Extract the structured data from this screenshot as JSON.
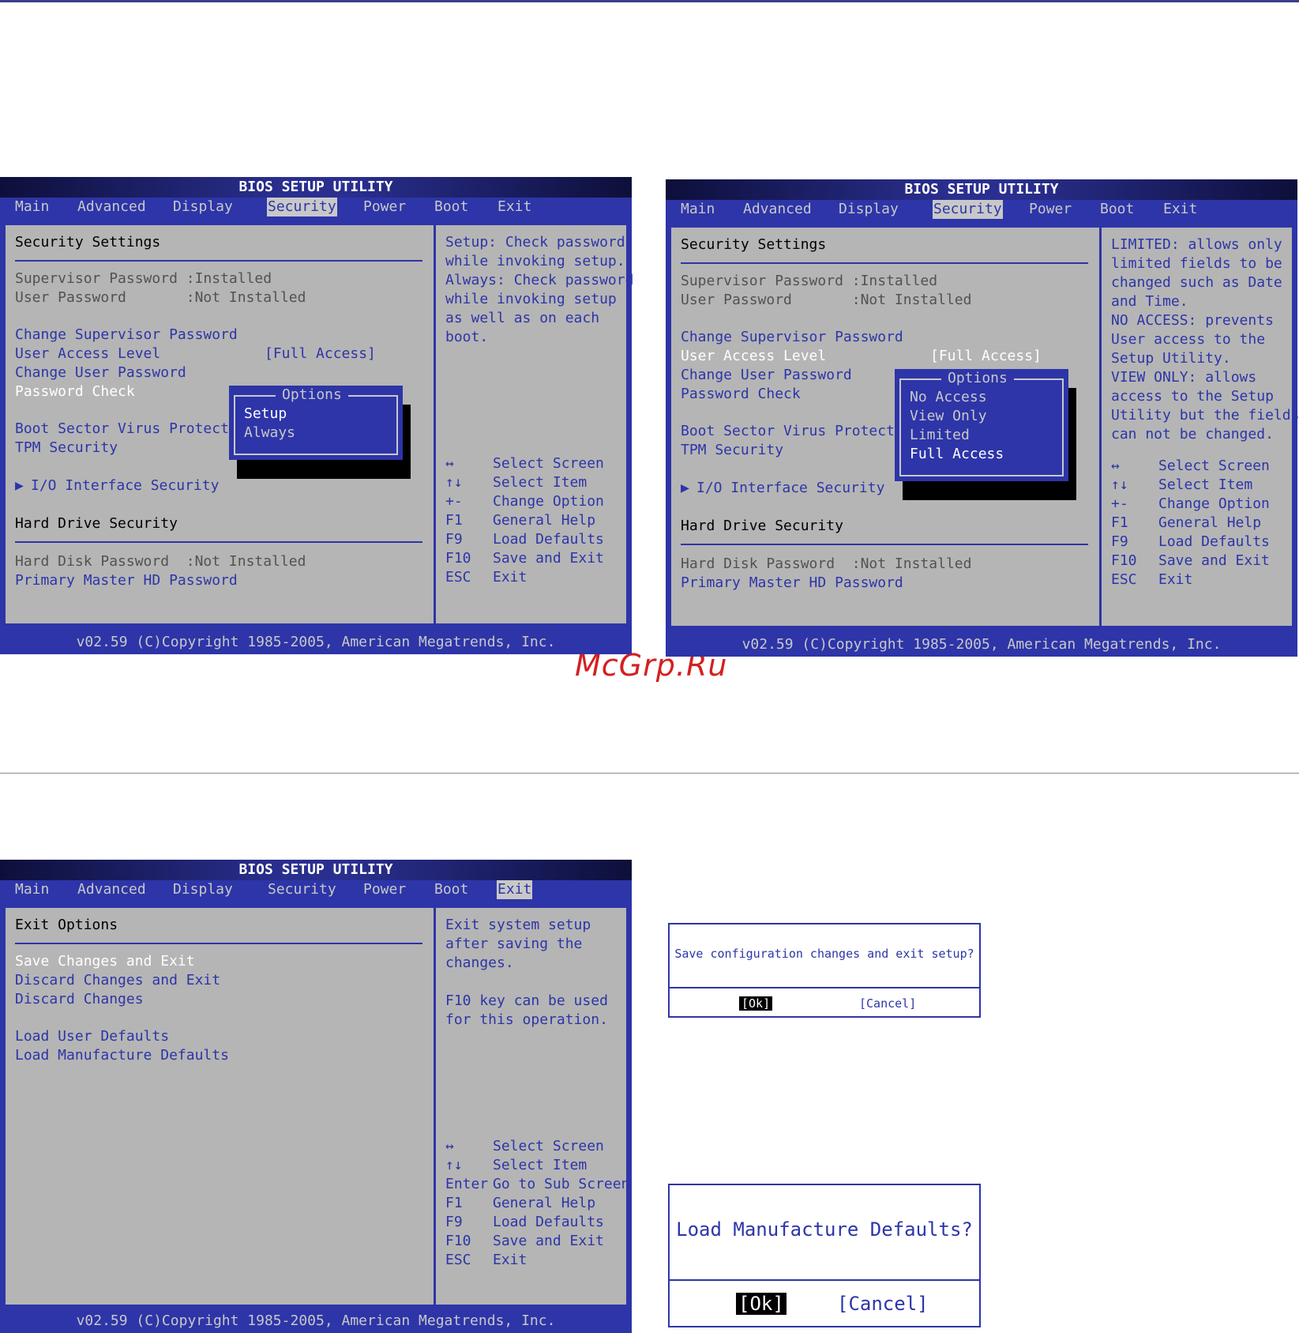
{
  "watermark": "McGrp.Ru",
  "common": {
    "title": "BIOS SETUP UTILITY",
    "menu": [
      "Main",
      "Advanced",
      "Display",
      "Security",
      "Power",
      "Boot",
      "Exit"
    ],
    "footer": "v02.59 (C)Copyright 1985-2005, American Megatrends, Inc."
  },
  "screen1": {
    "active_menu": "Security",
    "section_title": "Security Settings",
    "supervisor_label": "Supervisor Password :Installed",
    "user_label": "User Password       :Not Installed",
    "change_supervisor": "Change Supervisor Password",
    "user_access_level": "User Access Level",
    "user_access_value": "[Full Access]",
    "change_user": "Change User Password",
    "password_check": "Password Check",
    "boot_sector": "Boot Sector Virus Protectio",
    "tpm_security": "TPM Security",
    "io_interface": "I/O Interface Security",
    "hdd_section": "Hard Drive Security",
    "hdd_password": "Hard Disk Password  :Not Installed",
    "primary_master": "Primary Master HD Password",
    "popup": {
      "title": "Options",
      "options": [
        "Setup",
        "Always"
      ],
      "selected": 0
    },
    "help": [
      "Setup: Check password",
      "while invoking setup.",
      "Always: Check password",
      "while invoking setup",
      "as well as on each",
      "boot."
    ],
    "keys": [
      {
        "key": "↔",
        "desc": "Select Screen"
      },
      {
        "key": "↑↓",
        "desc": "Select Item"
      },
      {
        "key": "+-",
        "desc": "Change Option"
      },
      {
        "key": "F1",
        "desc": "General Help"
      },
      {
        "key": "F9",
        "desc": "Load Defaults"
      },
      {
        "key": "F10",
        "desc": "Save and Exit"
      },
      {
        "key": "ESC",
        "desc": "Exit"
      }
    ]
  },
  "screen2": {
    "active_menu": "Security",
    "section_title": "Security Settings",
    "supervisor_label": "Supervisor Password :Installed",
    "user_label": "User Password       :Not Installed",
    "change_supervisor": "Change Supervisor Password",
    "user_access_level": "User Access Level",
    "user_access_value": "[Full Access]",
    "change_user": "Change User Password",
    "password_check": "Password Check",
    "boot_sector": "Boot Sector Virus Protectio",
    "tpm_security": "TPM Security",
    "io_interface": "I/O Interface Security",
    "hdd_section": "Hard Drive Security",
    "hdd_password": "Hard Disk Password  :Not Installed",
    "primary_master": "Primary Master HD Password",
    "popup": {
      "title": "Options",
      "options": [
        "No Access",
        "View Only",
        "Limited",
        "Full Access"
      ],
      "selected": 3
    },
    "help": [
      "LIMITED: allows only",
      "limited fields to be",
      "changed such as Date",
      "and Time.",
      "NO ACCESS: prevents",
      "User access to the",
      "Setup Utility.",
      "VIEW ONLY: allows",
      "access to the Setup",
      "Utility but the fields",
      "can not be changed."
    ],
    "keys": [
      {
        "key": "↔",
        "desc": "Select Screen"
      },
      {
        "key": "↑↓",
        "desc": "Select Item"
      },
      {
        "key": "+-",
        "desc": "Change Option"
      },
      {
        "key": "F1",
        "desc": "General Help"
      },
      {
        "key": "F9",
        "desc": "Load Defaults"
      },
      {
        "key": "F10",
        "desc": "Save and Exit"
      },
      {
        "key": "ESC",
        "desc": "Exit"
      }
    ]
  },
  "screen3": {
    "active_menu": "Exit",
    "section_title": "Exit Options",
    "items": [
      "Save Changes and Exit",
      "Discard Changes and Exit",
      "Discard Changes",
      "Load User Defaults",
      "Load Manufacture Defaults"
    ],
    "help": [
      "Exit system setup",
      "after saving the",
      "changes.",
      "F10 key can be used",
      "for this operation."
    ],
    "keys": [
      {
        "key": "↔",
        "desc": "Select Screen"
      },
      {
        "key": "↑↓",
        "desc": "Select Item"
      },
      {
        "key": "Enter",
        "desc": "Go to Sub Screen"
      },
      {
        "key": "F1",
        "desc": "General Help"
      },
      {
        "key": "F9",
        "desc": "Load Defaults"
      },
      {
        "key": "F10",
        "desc": "Save and Exit"
      },
      {
        "key": "ESC",
        "desc": "Exit"
      }
    ]
  },
  "dialog_save": {
    "message": "Save configuration changes and exit setup?",
    "ok": "[Ok]",
    "cancel": "[Cancel]"
  },
  "dialog_load": {
    "message": "Load Manufacture Defaults?",
    "ok": "[Ok]",
    "cancel": "[Cancel]"
  }
}
